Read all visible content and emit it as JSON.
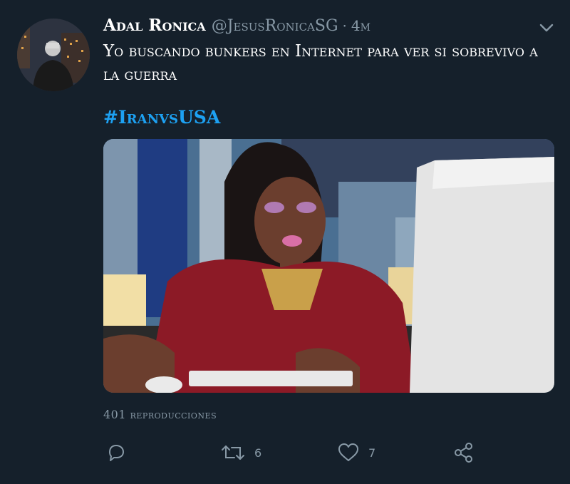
{
  "tweet": {
    "display_name": "Adal Ronica",
    "handle": "@JesusRonicaSG",
    "separator": "·",
    "time": "4m",
    "text": "Yo buscando bunkers en Internet para ver si sobrevivo a la guerra",
    "hashtag": "#IranvsUSA",
    "views": "401 reproducciones"
  },
  "actions": {
    "reply": {
      "icon": "reply-icon",
      "count": ""
    },
    "retweet": {
      "icon": "retweet-icon",
      "count": "6"
    },
    "like": {
      "icon": "heart-icon",
      "count": "7"
    },
    "share": {
      "icon": "share-icon",
      "count": ""
    }
  },
  "colors": {
    "background": "#15202b",
    "text": "#ffffff",
    "secondary": "#8899a6",
    "link": "#1da1f2"
  }
}
